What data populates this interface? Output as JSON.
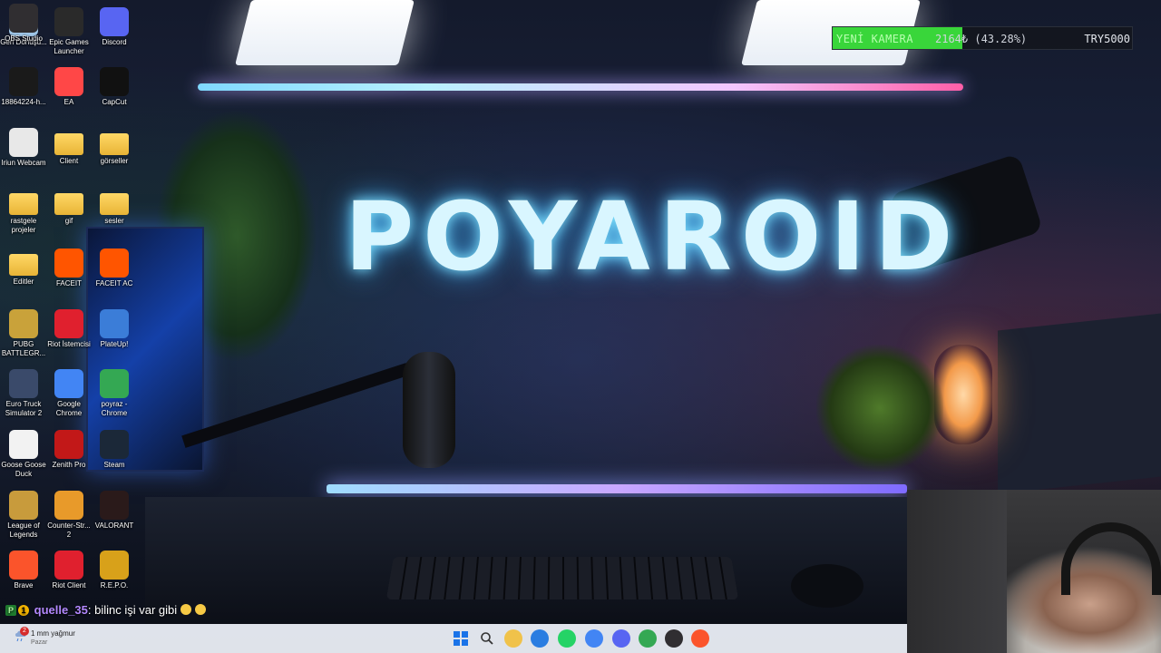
{
  "wallpaper": {
    "title": "POYAROID"
  },
  "donation": {
    "label": "YENİ KAMERA",
    "amount_text": "2164₺ (43.28%)",
    "goal": "TRY5000",
    "progress": 0.4328,
    "fill_color": "#39d63a"
  },
  "desktop_icons": [
    {
      "label": "Geri Dönüşü...",
      "icon": "recycle-bin-icon",
      "color": "#9fc6e8"
    },
    {
      "label": "Epic Games Launcher",
      "icon": "epic-games-icon",
      "color": "#2a2a2a"
    },
    {
      "label": "Discord",
      "icon": "discord-icon",
      "color": "#5865f2"
    },
    {
      "label": "18864224-h...",
      "icon": "video-file-icon",
      "color": "#1a1a1a"
    },
    {
      "label": "EA",
      "icon": "ea-icon",
      "color": "#ff4747"
    },
    {
      "label": "CapCut",
      "icon": "capcut-icon",
      "color": "#111111"
    },
    {
      "label": "Iriun Webcam",
      "icon": "iriun-webcam-icon",
      "color": "#e8e8e8"
    },
    {
      "label": "Client",
      "icon": "folder-icon",
      "color": "#f0c24a"
    },
    {
      "label": "görseller",
      "icon": "folder-icon",
      "color": "#f0c24a"
    },
    {
      "label": "rastgele projeler",
      "icon": "folder-icon",
      "color": "#f0c24a"
    },
    {
      "label": "gif",
      "icon": "folder-icon",
      "color": "#f0c24a"
    },
    {
      "label": "sesler",
      "icon": "folder-icon",
      "color": "#f0c24a"
    },
    {
      "label": "Editler",
      "icon": "folder-icon",
      "color": "#f0c24a"
    },
    {
      "label": "FACEIT",
      "icon": "faceit-icon",
      "color": "#ff5500"
    },
    {
      "label": "FACEIT AC",
      "icon": "faceit-ac-icon",
      "color": "#ff5500"
    },
    {
      "label": "PUBG BATTLEGR...",
      "icon": "pubg-icon",
      "color": "#c9a23a"
    },
    {
      "label": "Riot İstemcisi",
      "icon": "riot-client-icon",
      "color": "#e0202e"
    },
    {
      "label": "PlateUp!",
      "icon": "plateup-icon",
      "color": "#3b7dd8"
    },
    {
      "label": "Euro Truck Simulator 2",
      "icon": "euro-truck-icon",
      "color": "#3a4a6a"
    },
    {
      "label": "Google Chrome",
      "icon": "chrome-icon",
      "color": "#4285f4"
    },
    {
      "label": "poyraz - Chrome",
      "icon": "chrome-profile-icon",
      "color": "#34a853"
    },
    {
      "label": "Goose Goose Duck",
      "icon": "goose-goose-duck-icon",
      "color": "#f2f2f2"
    },
    {
      "label": "Zenith Pro",
      "icon": "zenith-pro-icon",
      "color": "#c21818"
    },
    {
      "label": "Steam",
      "icon": "steam-icon",
      "color": "#1b2838"
    },
    {
      "label": "League of Legends",
      "icon": "league-of-legends-icon",
      "color": "#c89b3c"
    },
    {
      "label": "Counter-Str... 2",
      "icon": "counter-strike-icon",
      "color": "#e89a2a"
    },
    {
      "label": "VALORANT",
      "icon": "valorant-icon",
      "color": "#2a1a1a"
    },
    {
      "label": "Brave",
      "icon": "brave-icon",
      "color": "#fb542b"
    },
    {
      "label": "Riot Client",
      "icon": "riot-client-icon",
      "color": "#e0202e"
    },
    {
      "label": "R.E.P.O.",
      "icon": "repo-icon",
      "color": "#d8a11a"
    },
    {
      "label": "OBS Studio",
      "icon": "obs-icon",
      "color": "#302e31"
    }
  ],
  "chat": {
    "username": "quelle_35",
    "message": ": bilinc işi var gibi",
    "badge1": "P",
    "badge2": "1"
  },
  "weather": {
    "badge": "2",
    "text": "1 mm yağmur",
    "day": "Pazar"
  },
  "taskbar_icons": [
    {
      "icon": "windows-start-icon",
      "color": "#1a73e8"
    },
    {
      "icon": "search-icon",
      "color": "#333333"
    },
    {
      "icon": "file-explorer-icon",
      "color": "#f0c24a"
    },
    {
      "icon": "microsoft-store-icon",
      "color": "#2a7de1"
    },
    {
      "icon": "whatsapp-icon",
      "color": "#25d366"
    },
    {
      "icon": "chrome-icon",
      "color": "#4285f4"
    },
    {
      "icon": "discord-icon",
      "color": "#5865f2"
    },
    {
      "icon": "chrome-icon",
      "color": "#34a853"
    },
    {
      "icon": "obs-icon",
      "color": "#302e31"
    },
    {
      "icon": "brave-icon",
      "color": "#fb542b"
    }
  ]
}
